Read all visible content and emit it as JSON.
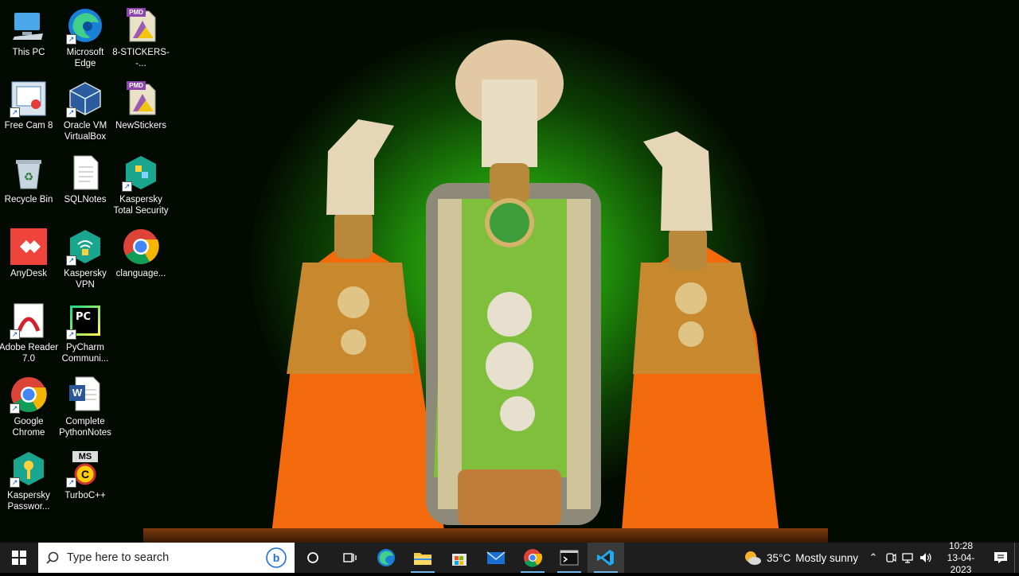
{
  "desktop": {
    "icons": [
      {
        "label": "This PC"
      },
      {
        "label": "Microsoft Edge"
      },
      {
        "label": "8-STICKERS--..."
      },
      {
        "label": "Free Cam 8"
      },
      {
        "label": "Oracle VM VirtualBox"
      },
      {
        "label": "NewStickers"
      },
      {
        "label": "Recycle Bin"
      },
      {
        "label": "SQLNotes"
      },
      {
        "label": "Kaspersky Total Security"
      },
      {
        "label": "AnyDesk"
      },
      {
        "label": "Kaspersky VPN"
      },
      {
        "label": "clanguage..."
      },
      {
        "label": "Adobe Reader 7.0"
      },
      {
        "label": "PyCharm Communi..."
      },
      {
        "label": "Google Chrome"
      },
      {
        "label": "Complete PythonNotes"
      },
      {
        "label": "Kaspersky Passwor..."
      },
      {
        "label": "TurboC++"
      }
    ],
    "badges": {
      "pmd": "PMD",
      "pc": "PC",
      "ms": "MS",
      "word": "W"
    }
  },
  "taskbar": {
    "search_placeholder": "Type here to search",
    "weather_temp": "35°C",
    "weather_text": "Mostly sunny",
    "time": "10:28",
    "date": "13-04-2023"
  },
  "colors": {
    "taskbar": "#1e1e1e",
    "accent": "#76b9ed",
    "wallpaper_green": "#3ecb12"
  }
}
